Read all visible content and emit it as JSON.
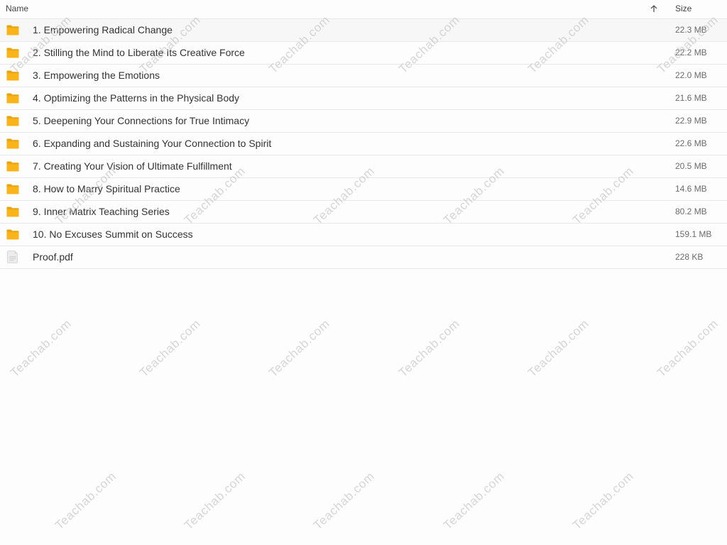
{
  "header": {
    "name_label": "Name",
    "size_label": "Size",
    "sort_icon": "arrow-upward-icon"
  },
  "items": [
    {
      "icon": "folder-icon",
      "name": "1. Empowering Radical Change",
      "size": "22.3 MB"
    },
    {
      "icon": "folder-icon",
      "name": "2. Stilling the Mind to Liberate Its Creative Force",
      "size": "22.2 MB"
    },
    {
      "icon": "folder-icon",
      "name": "3. Empowering the Emotions",
      "size": "22.0 MB"
    },
    {
      "icon": "folder-icon",
      "name": "4. Optimizing the Patterns in the Physical Body",
      "size": "21.6 MB"
    },
    {
      "icon": "folder-icon",
      "name": "5. Deepening Your Connections for True Intimacy",
      "size": "22.9 MB"
    },
    {
      "icon": "folder-icon",
      "name": "6. Expanding and Sustaining Your Connection to Spirit",
      "size": "22.6 MB"
    },
    {
      "icon": "folder-icon",
      "name": "7. Creating Your Vision of Ultimate Fulfillment",
      "size": "20.5 MB"
    },
    {
      "icon": "folder-icon",
      "name": "8. How to Marry Spiritual Practice",
      "size": "14.6 MB"
    },
    {
      "icon": "folder-icon",
      "name": "9. Inner Matrix Teaching Series",
      "size": "80.2 MB"
    },
    {
      "icon": "folder-icon",
      "name": "10. No Excuses Summit on Success",
      "size": "159.1 MB"
    },
    {
      "icon": "pdf-file-icon",
      "name": "Proof.pdf",
      "size": "228 KB"
    }
  ],
  "watermark": "Teachab.com",
  "colors": {
    "folder": "#f8b418",
    "folder_back": "#e9a30c",
    "text": "#333333",
    "muted": "#6b6b6b",
    "border": "#e8e8e8",
    "file": "#ececec",
    "watermark": "#c9c9c9"
  }
}
